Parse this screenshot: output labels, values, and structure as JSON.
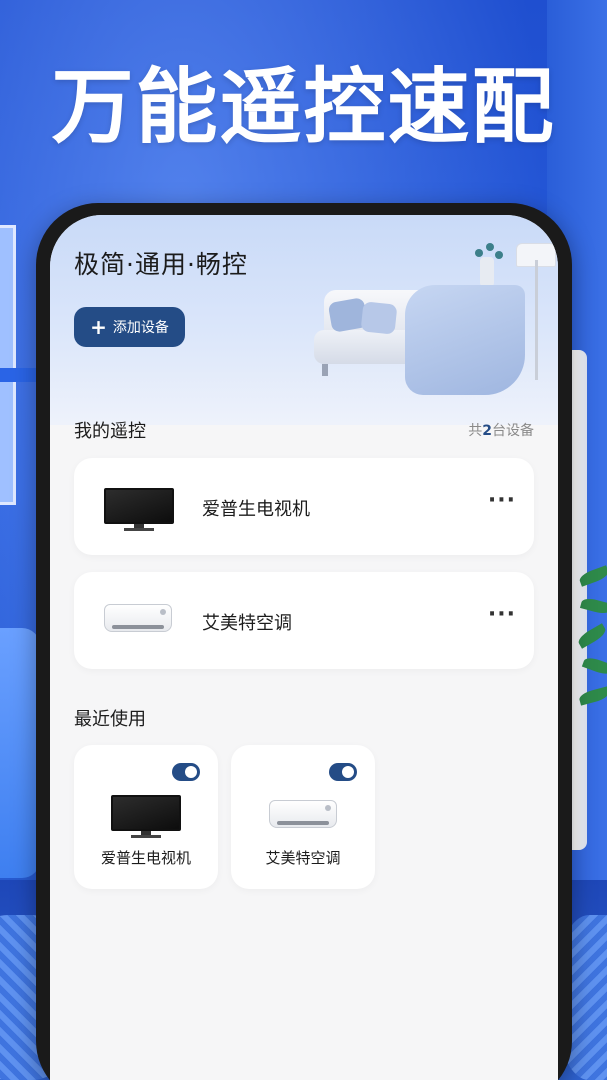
{
  "headline": "万能遥控速配",
  "hero": {
    "title": "极简·通用·畅控",
    "add_button_label": "添加设备"
  },
  "my_remotes": {
    "title": "我的遥控",
    "count_prefix": "共",
    "count_value": "2",
    "count_suffix": "台设备",
    "devices": [
      {
        "name": "爱普生电视机",
        "type": "tv-icon",
        "more": "···"
      },
      {
        "name": "艾美特空调",
        "type": "ac-icon",
        "more": "···"
      }
    ]
  },
  "recent": {
    "title": "最近使用",
    "items": [
      {
        "name": "爱普生电视机",
        "type": "tv-icon",
        "enabled": true
      },
      {
        "name": "艾美特空调",
        "type": "ac-icon",
        "enabled": true
      }
    ]
  },
  "colors": {
    "accent": "#244c86",
    "background": "#2557c9"
  }
}
